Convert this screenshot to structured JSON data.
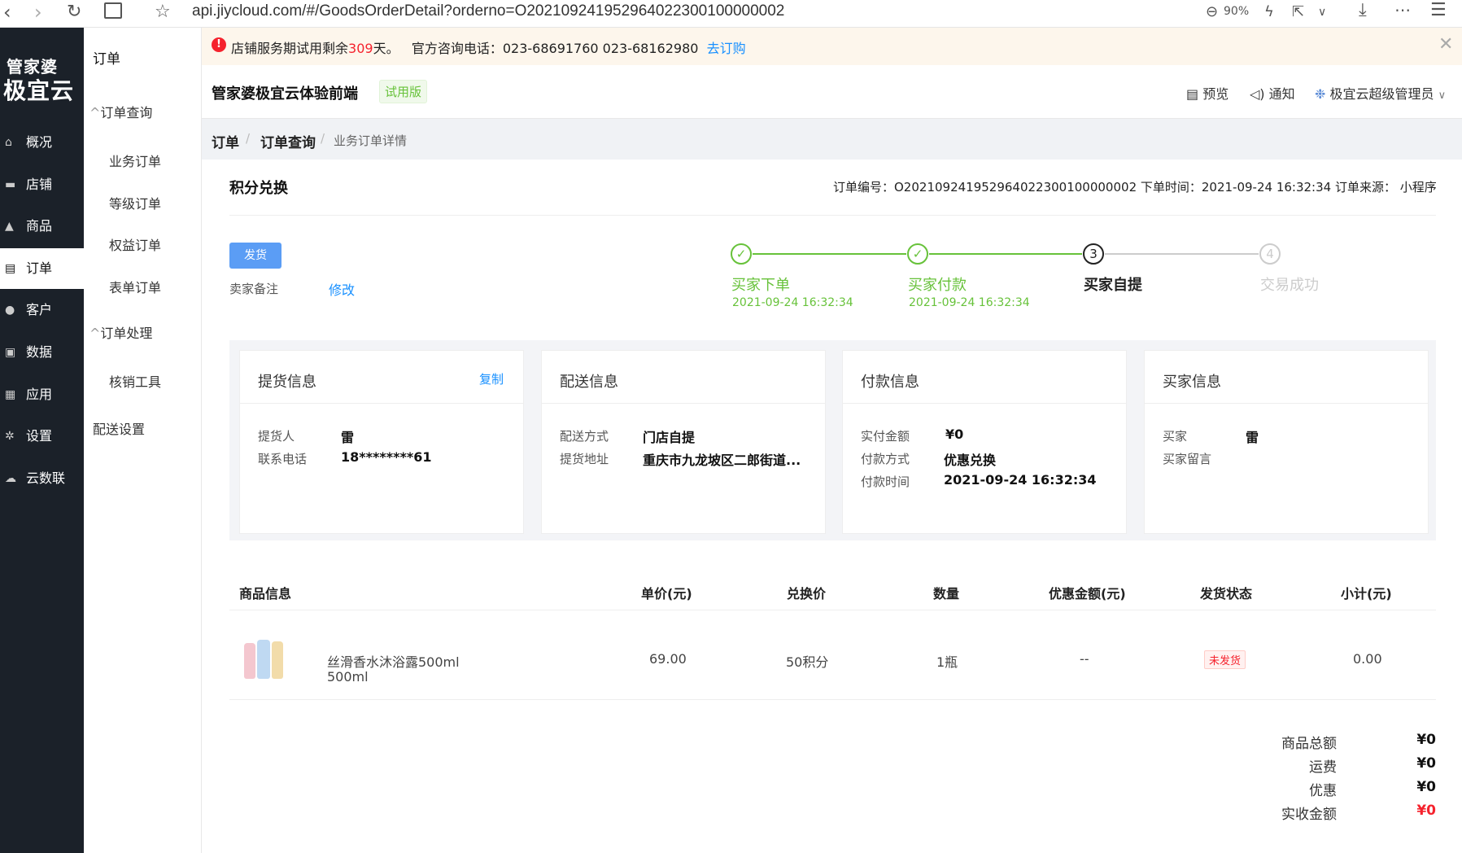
{
  "browser": {
    "url": "api.jiycloud.com/#/GoodsOrderDetail?orderno=O202109241952964022300100000002",
    "zoom": "90%"
  },
  "logo": {
    "line1": "管家婆",
    "line2": "极宜云"
  },
  "sidebar": {
    "items": [
      {
        "label": "概况",
        "icon": "home-icon"
      },
      {
        "label": "店铺",
        "icon": "shop-icon"
      },
      {
        "label": "商品",
        "icon": "goods-icon"
      },
      {
        "label": "订单",
        "icon": "order-icon"
      },
      {
        "label": "客户",
        "icon": "user-icon"
      },
      {
        "label": "数据",
        "icon": "chart-icon"
      },
      {
        "label": "应用",
        "icon": "grid-icon"
      },
      {
        "label": "设置",
        "icon": "gear-icon"
      },
      {
        "label": "云数联",
        "icon": "cloud-icon"
      }
    ]
  },
  "submenu": {
    "title": "订单",
    "group1": "订单查询",
    "items1": [
      "业务订单",
      "等级订单",
      "权益订单",
      "表单订单"
    ],
    "group2": "订单处理",
    "items2": [
      "核销工具"
    ],
    "extra": "配送设置"
  },
  "notice": {
    "prefix": "店铺服务期试用剩余",
    "days": "309",
    "suffix": "天。",
    "phone": "官方咨询电话：023-68691760 023-68162980",
    "link": "去订购"
  },
  "header": {
    "store": "管家婆极宜云体验前端",
    "badge": "试用版",
    "preview": "预览",
    "notify": "通知",
    "admin": "极宜云超级管理员"
  },
  "breadcrumb": [
    "订单",
    "订单查询",
    "业务订单详情"
  ],
  "order": {
    "title": "积分兑换",
    "meta": "订单编号：O202109241952964022300100000002 下单时间：2021-09-24 16:32:34 订单来源： 小程序",
    "ship_button": "发货",
    "remark_label": "卖家备注",
    "remark_edit": "修改"
  },
  "steps": [
    {
      "no": "1",
      "label": "买家下单",
      "time": "2021-09-24 16:32:34",
      "state": "done"
    },
    {
      "no": "2",
      "label": "买家付款",
      "time": "2021-09-24 16:32:34",
      "state": "done"
    },
    {
      "no": "3",
      "label": "买家自提",
      "time": "",
      "state": "current"
    },
    {
      "no": "4",
      "label": "交易成功",
      "time": "",
      "state": "pending"
    }
  ],
  "cards": {
    "pickup": {
      "title": "提货信息",
      "copy": "复制",
      "k1": "提货人",
      "v1": "雷",
      "k2": "联系电话",
      "v2": "18********61"
    },
    "delivery": {
      "title": "配送信息",
      "k1": "配送方式",
      "v1": "门店自提",
      "k2": "提货地址",
      "v2": "重庆市九龙坡区二郎街道..."
    },
    "payment": {
      "title": "付款信息",
      "k1": "实付金额",
      "v1": "¥0",
      "k2": "付款方式",
      "v2": "优惠兑换",
      "k3": "付款时间",
      "v3": "2021-09-24 16:32:34"
    },
    "buyer": {
      "title": "买家信息",
      "k1": "买家",
      "v1": "雷",
      "k2": "买家留言",
      "v2": ""
    }
  },
  "table": {
    "headers": [
      "商品信息",
      "单价(元)",
      "兑换价",
      "数量",
      "优惠金额(元)",
      "发货状态",
      "小计(元)"
    ],
    "row": {
      "name": "丝滑香水沐浴露500ml",
      "spec": "500ml",
      "price": "69.00",
      "exchange": "50积分",
      "qty": "1瓶",
      "discount": "--",
      "status": "未发货",
      "subtotal": "0.00"
    }
  },
  "summary": [
    {
      "label": "商品总额",
      "value": "¥0"
    },
    {
      "label": "运费",
      "value": "¥0"
    },
    {
      "label": "优惠",
      "value": "¥0"
    },
    {
      "label": "实收金额",
      "value": "¥0"
    }
  ],
  "colors": {
    "sidebar": "#1b2129",
    "accent": "#1890ff",
    "success": "#67c23a",
    "danger": "#f5222d",
    "notice_bg": "#fdf6ec"
  }
}
